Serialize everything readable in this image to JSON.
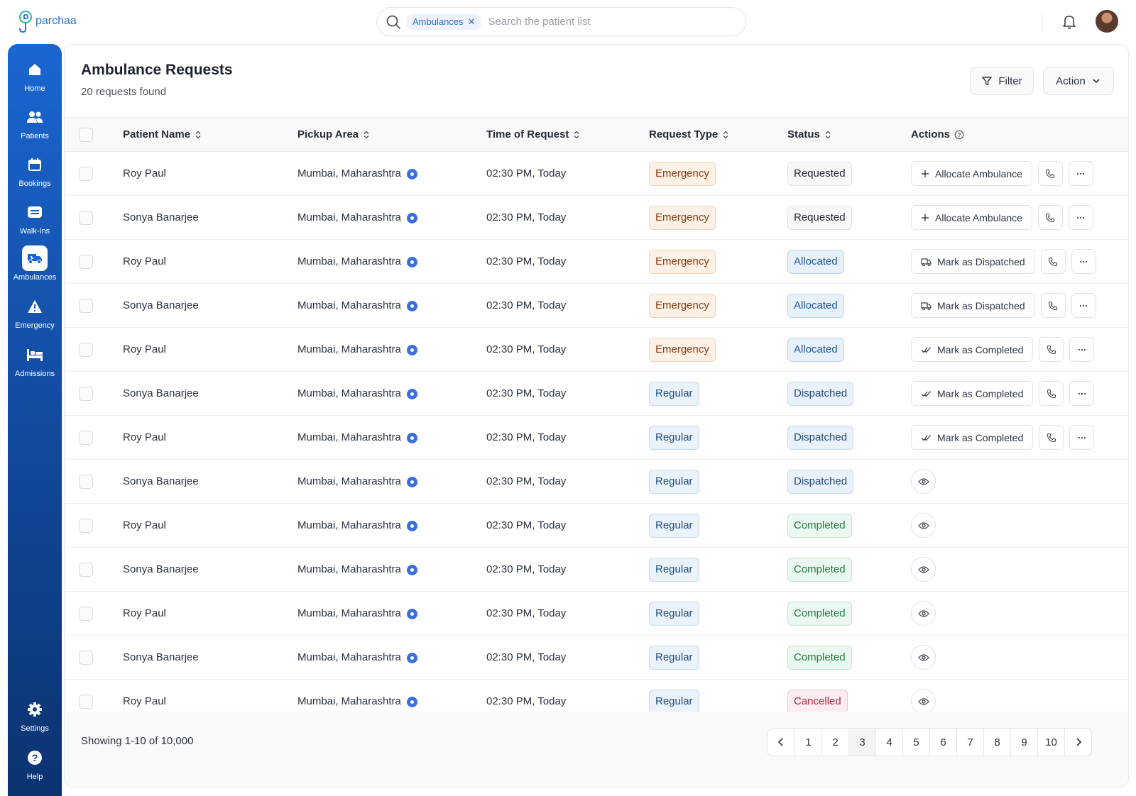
{
  "app": {
    "logo_text": "parchaa"
  },
  "search": {
    "chip_label": "Ambulances",
    "placeholder": "Search the patient list"
  },
  "sidebar": {
    "items": [
      {
        "label": "Home",
        "icon": "home-icon"
      },
      {
        "label": "Patients",
        "icon": "patients-icon"
      },
      {
        "label": "Bookings",
        "icon": "calendar-icon"
      },
      {
        "label": "Walk-Ins",
        "icon": "walk-in-icon"
      },
      {
        "label": "Ambulances",
        "icon": "ambulance-icon",
        "active": true
      },
      {
        "label": "Emergency",
        "icon": "warning-icon"
      },
      {
        "label": "Admissions",
        "icon": "bed-icon"
      },
      {
        "label": "Settings",
        "icon": "gear-icon"
      },
      {
        "label": "Help",
        "icon": "help-icon"
      }
    ]
  },
  "page": {
    "title": "Ambulance Requests",
    "subtitle": "20 requests found",
    "filter_label": "Filter",
    "action_label": "Action"
  },
  "table": {
    "headers": {
      "patient": "Patient Name",
      "pickup": "Pickup Area",
      "time": "Time of Request",
      "type": "Request Type",
      "status": "Status",
      "actions": "Actions"
    },
    "rows": [
      {
        "name": "Roy Paul",
        "area": "Mumbai, Maharashtra",
        "time": "02:30 PM, Today",
        "type": "Emergency",
        "status": "Requested",
        "action": "Allocate Ambulance"
      },
      {
        "name": "Sonya Banarjee",
        "area": "Mumbai, Maharashtra",
        "time": "02:30 PM, Today",
        "type": "Emergency",
        "status": "Requested",
        "action": "Allocate Ambulance"
      },
      {
        "name": "Roy Paul",
        "area": "Mumbai, Maharashtra",
        "time": "02:30 PM, Today",
        "type": "Emergency",
        "status": "Allocated",
        "action": "Mark as Dispatched"
      },
      {
        "name": "Sonya Banarjee",
        "area": "Mumbai, Maharashtra",
        "time": "02:30 PM, Today",
        "type": "Emergency",
        "status": "Allocated",
        "action": "Mark as Dispatched"
      },
      {
        "name": "Roy Paul",
        "area": "Mumbai, Maharashtra",
        "time": "02:30 PM, Today",
        "type": "Emergency",
        "status": "Allocated",
        "action": "Mark as Completed"
      },
      {
        "name": "Sonya Banarjee",
        "area": "Mumbai, Maharashtra",
        "time": "02:30 PM, Today",
        "type": "Regular",
        "status": "Dispatched",
        "action": "Mark as Completed"
      },
      {
        "name": "Roy Paul",
        "area": "Mumbai, Maharashtra",
        "time": "02:30 PM, Today",
        "type": "Regular",
        "status": "Dispatched",
        "action": "Mark as Completed"
      },
      {
        "name": "Sonya Banarjee",
        "area": "Mumbai, Maharashtra",
        "time": "02:30 PM, Today",
        "type": "Regular",
        "status": "Dispatched",
        "action": ""
      },
      {
        "name": "Roy Paul",
        "area": "Mumbai, Maharashtra",
        "time": "02:30 PM, Today",
        "type": "Regular",
        "status": "Completed",
        "action": ""
      },
      {
        "name": "Sonya Banarjee",
        "area": "Mumbai, Maharashtra",
        "time": "02:30 PM, Today",
        "type": "Regular",
        "status": "Completed",
        "action": ""
      },
      {
        "name": "Roy Paul",
        "area": "Mumbai, Maharashtra",
        "time": "02:30 PM, Today",
        "type": "Regular",
        "status": "Completed",
        "action": ""
      },
      {
        "name": "Sonya Banarjee",
        "area": "Mumbai, Maharashtra",
        "time": "02:30 PM, Today",
        "type": "Regular",
        "status": "Completed",
        "action": ""
      },
      {
        "name": "Roy Paul",
        "area": "Mumbai, Maharashtra",
        "time": "02:30 PM, Today",
        "type": "Regular",
        "status": "Cancelled",
        "action": ""
      }
    ]
  },
  "footer": {
    "showing": "Showing 1-10 of 10,000",
    "pages": [
      "1",
      "2",
      "3",
      "4",
      "5",
      "6",
      "7",
      "8",
      "9",
      "10"
    ],
    "current_page": "3"
  },
  "colors": {
    "accent": "#1a66d1",
    "emergency": "#8a3b10",
    "completed": "#1f7a44",
    "cancelled": "#b0263f"
  }
}
